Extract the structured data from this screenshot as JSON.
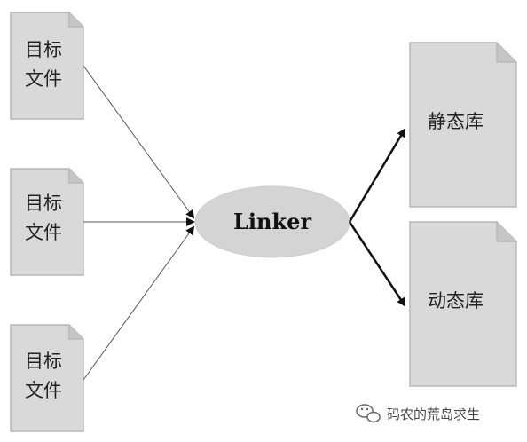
{
  "inputs": [
    {
      "line1": "目标",
      "line2": "文件"
    },
    {
      "line1": "目标",
      "line2": "文件"
    },
    {
      "line1": "目标",
      "line2": "文件"
    }
  ],
  "linker": {
    "label": "Linker"
  },
  "outputs": [
    {
      "label": "静态库"
    },
    {
      "label": "动态库"
    }
  ],
  "watermark": {
    "text": "码农的荒岛求生",
    "icon": "wechat-icon"
  },
  "colors": {
    "document_fill": "#d9d9d9",
    "document_stroke": "#b7b7b7",
    "ellipse_fill": "#d4d4d4",
    "arrow": "#111111",
    "thin_line": "#555555"
  }
}
